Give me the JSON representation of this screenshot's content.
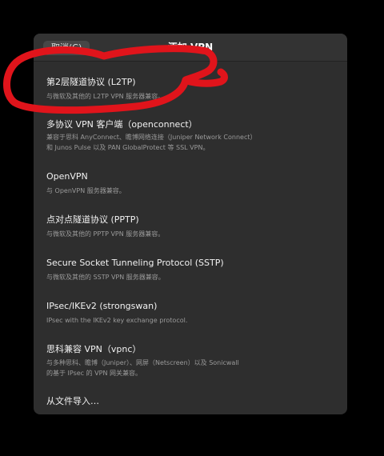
{
  "dialog": {
    "title": "添加 VPN",
    "cancel_label": "取消(C)"
  },
  "options": [
    {
      "title": "第2层隧道协议 (L2TP)",
      "description": "与微软及其他的 L2TP VPN 服务器兼容。"
    },
    {
      "title": "多协议 VPN 客户端（openconnect）",
      "description": "兼容于思科 AnyConnect、瞻博网络连接（Juniper Network Connect）和 Junos Pulse 以及 PAN GlobalProtect 等 SSL VPN。"
    },
    {
      "title": "OpenVPN",
      "description": "与 OpenVPN 服务器兼容。"
    },
    {
      "title": "点对点隧道协议 (PPTP)",
      "description": "与微软及其他的 PPTP VPN 服务器兼容。"
    },
    {
      "title": "Secure Socket Tunneling Protocol (SSTP)",
      "description": "与微软及其他的 SSTP VPN 服务器兼容。"
    },
    {
      "title": "IPsec/IKEv2 (strongswan)",
      "description": "IPsec with the IKEv2 key exchange protocol."
    },
    {
      "title": "思科兼容 VPN（vpnc）",
      "description": "与多种思科、瞻博（Juniper）、网屏（Netscreen）以及 Sonicwall 的基于 IPsec 的 VPN 网关兼容。"
    },
    {
      "title": "从文件导入…",
      "description": ""
    }
  ],
  "annotation": {
    "stroke_color": "#e0141b"
  }
}
